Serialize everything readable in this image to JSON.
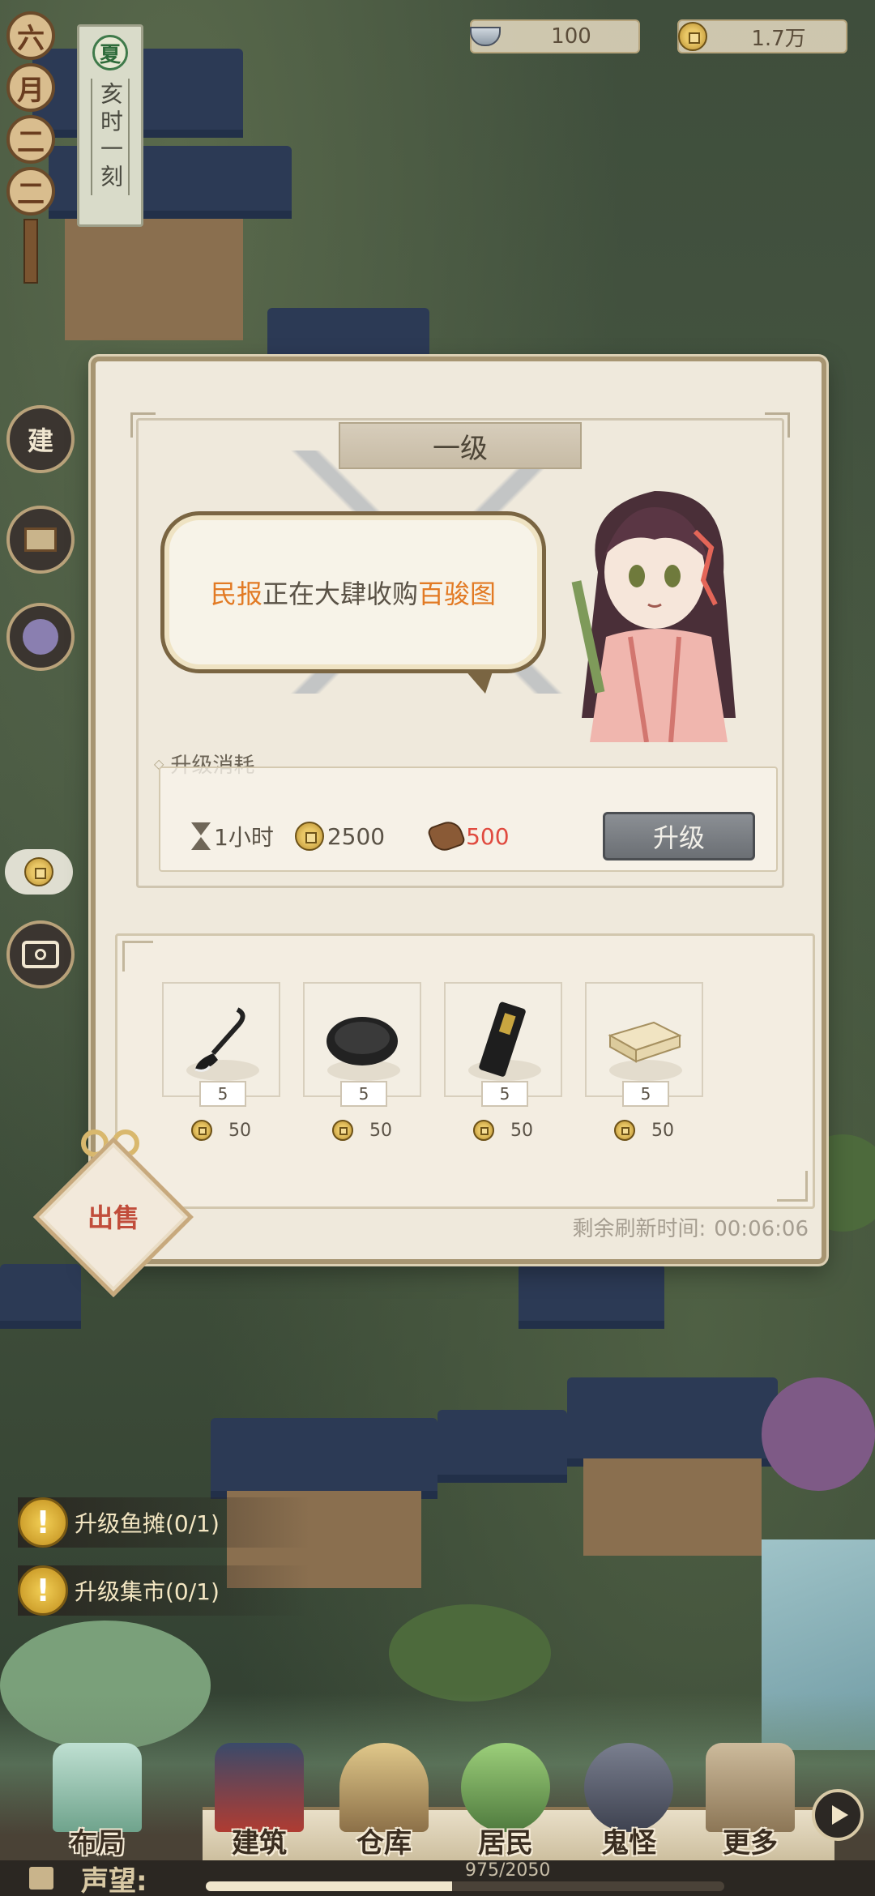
{
  "resources": {
    "silver": "100",
    "coins": "1.7万"
  },
  "calendar": {
    "month_chars": [
      "六",
      "月",
      "二",
      "二"
    ],
    "season": "夏",
    "time": "亥时一刻"
  },
  "side_buttons": {
    "build_label": "建"
  },
  "panel": {
    "level_title": "一级",
    "speech": {
      "part1": "民报",
      "part2": "正在大肆收购",
      "part3": "百骏图"
    },
    "upgrade_cost": {
      "label": "升级消耗",
      "time": "1小时",
      "coins": "2500",
      "wood": "500"
    },
    "upgrade_button": "升级",
    "shop_items": [
      {
        "name": "毛笔",
        "qty": "5",
        "price": "50"
      },
      {
        "name": "砚台",
        "qty": "5",
        "price": "50"
      },
      {
        "name": "墨锭",
        "qty": "5",
        "price": "50"
      },
      {
        "name": "宣纸",
        "qty": "5",
        "price": "50"
      }
    ],
    "refresh_label": "剩余刷新时间:",
    "refresh_time": "00:06:06"
  },
  "sell_label": "出售",
  "quests": [
    {
      "text": "升级鱼摊(0/1)"
    },
    {
      "text": "升级集市(0/1)"
    }
  ],
  "nav": [
    {
      "label": "布局"
    },
    {
      "label": "建筑"
    },
    {
      "label": "仓库"
    },
    {
      "label": "居民"
    },
    {
      "label": "鬼怪"
    },
    {
      "label": "更多"
    }
  ],
  "reputation": {
    "label": "声望:",
    "current": 975,
    "max": 2050,
    "text": "975/2050"
  },
  "colors": {
    "highlight": "#e27a24",
    "insufficient": "#e04a3f",
    "panel_bg": "#efe9dc"
  }
}
